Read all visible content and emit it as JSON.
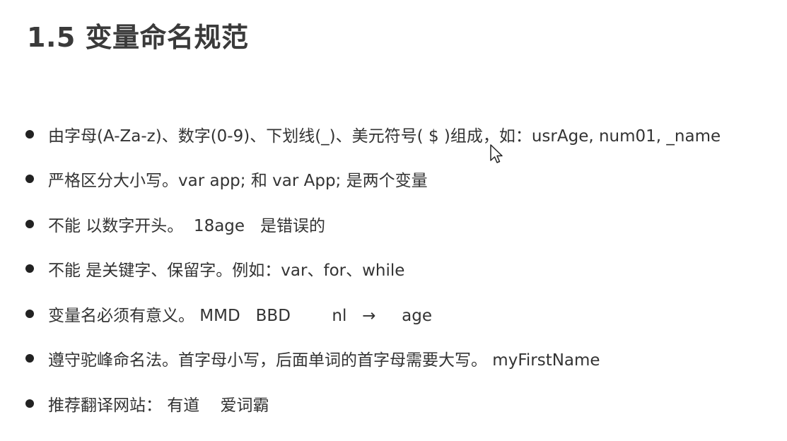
{
  "slide": {
    "title": "1.5 变量命名规范",
    "bullets": [
      "由字母(A-Za-z)、数字(0-9)、下划线(_)、美元符号( $ )组成，如：usrAge, num01, _name",
      "严格区分大小写。var app; 和 var App; 是两个变量",
      "不能 以数字开头。  18age   是错误的",
      "不能 是关键字、保留字。例如：var、for、while",
      "变量名必须有意义。 MMD   BBD        nl   →     age",
      "遵守驼峰命名法。首字母小写，后面单词的首字母需要大写。 myFirstName",
      "推荐翻译网站： 有道    爱词霸"
    ]
  },
  "cursor": {
    "icon": "mouse-pointer-icon"
  }
}
